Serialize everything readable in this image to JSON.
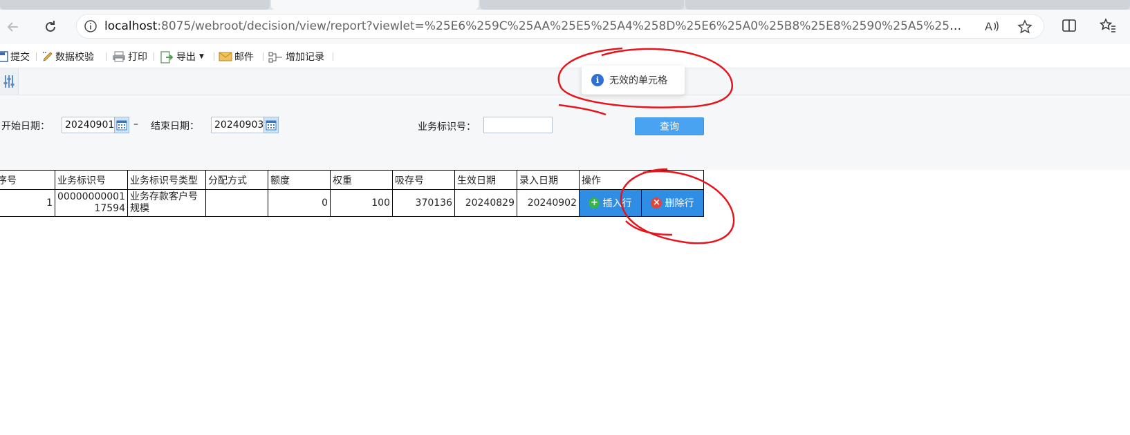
{
  "browser": {
    "url_host": "localhost",
    "url_path": ":8075/webroot/decision/view/report?viewlet=%25E6%259C%25AA%25E5%25A4%258D%25E6%25A0%25B8%25E8%2590%25A5%25E9%2594%2580..."
  },
  "toolbar": {
    "submit": "提交",
    "validate": "数据校验",
    "print": "打印",
    "export": "导出",
    "mail": "邮件",
    "add_record": "增加记录"
  },
  "toast": {
    "message": "无效的单元格"
  },
  "params": {
    "start_label": "开始日期：",
    "start_value": "20240901",
    "dash": "–",
    "end_label": "结束日期：",
    "end_value": "20240903",
    "id_label": "业务标识号：",
    "id_value": "",
    "query": "查询"
  },
  "table": {
    "headers": [
      "序号",
      "业务标识号",
      "业务标识号类型",
      "分配方式",
      "额度",
      "权重",
      "吸存号",
      "生效日期",
      "录入日期",
      "操作"
    ],
    "rows": [
      {
        "seq": "1",
        "biz_id_line1": "00000000001",
        "biz_id_line2": "17594",
        "type_line1": "业务存款客户号",
        "type_line2": "规模",
        "method": "",
        "amount": "0",
        "weight": "100",
        "deposit_no": "370136",
        "effective_date": "20240829",
        "entry_date": "20240902",
        "insert": "插入行",
        "delete": "删除行"
      }
    ]
  },
  "colors": {
    "accent": "#4aa3f0",
    "op_button": "#2f8de3",
    "annotation": "#e8141b"
  }
}
